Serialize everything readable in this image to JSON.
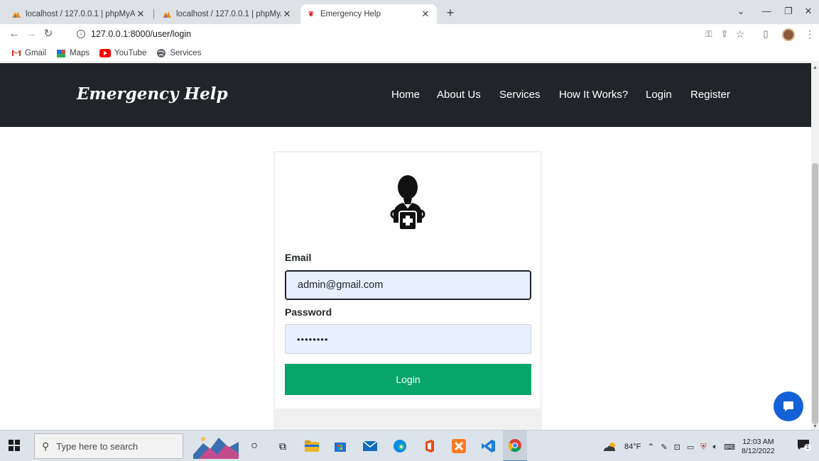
{
  "browser": {
    "tabs": [
      {
        "title": "localhost / 127.0.0.1 | phpMyAdm",
        "favicon": "phpmyadmin-icon"
      },
      {
        "title": "localhost / 127.0.0.1 | phpMyAdm",
        "favicon": "phpmyadmin-icon"
      },
      {
        "title": "Emergency Help",
        "favicon": "site-icon",
        "active": true
      }
    ],
    "new_tab": "+",
    "url": "127.0.0.1:8000/user/login",
    "bookmarks": [
      {
        "label": "Gmail",
        "icon": "gmail-icon"
      },
      {
        "label": "Maps",
        "icon": "maps-icon"
      },
      {
        "label": "YouTube",
        "icon": "youtube-icon"
      },
      {
        "label": "Services",
        "icon": "globe-icon"
      }
    ]
  },
  "site": {
    "brand": "Emergency Help",
    "nav": [
      "Home",
      "About Us",
      "Services",
      "How It Works?",
      "Login",
      "Register"
    ]
  },
  "login_form": {
    "email_label": "Email",
    "email_value": "admin@gmail.com",
    "password_label": "Password",
    "password_value": "••••••••",
    "submit_label": "Login",
    "avatar_icon": "doctor-icon"
  },
  "taskbar": {
    "search_placeholder": "Type here to search",
    "weather": "84°F",
    "time": "12:03 AM",
    "date": "8/12/2022",
    "notification_count": "1"
  },
  "colors": {
    "navbar": "#212529",
    "login_button": "#08a56b",
    "input_fill": "#e8f0fe",
    "chat_button": "#1461d7"
  }
}
